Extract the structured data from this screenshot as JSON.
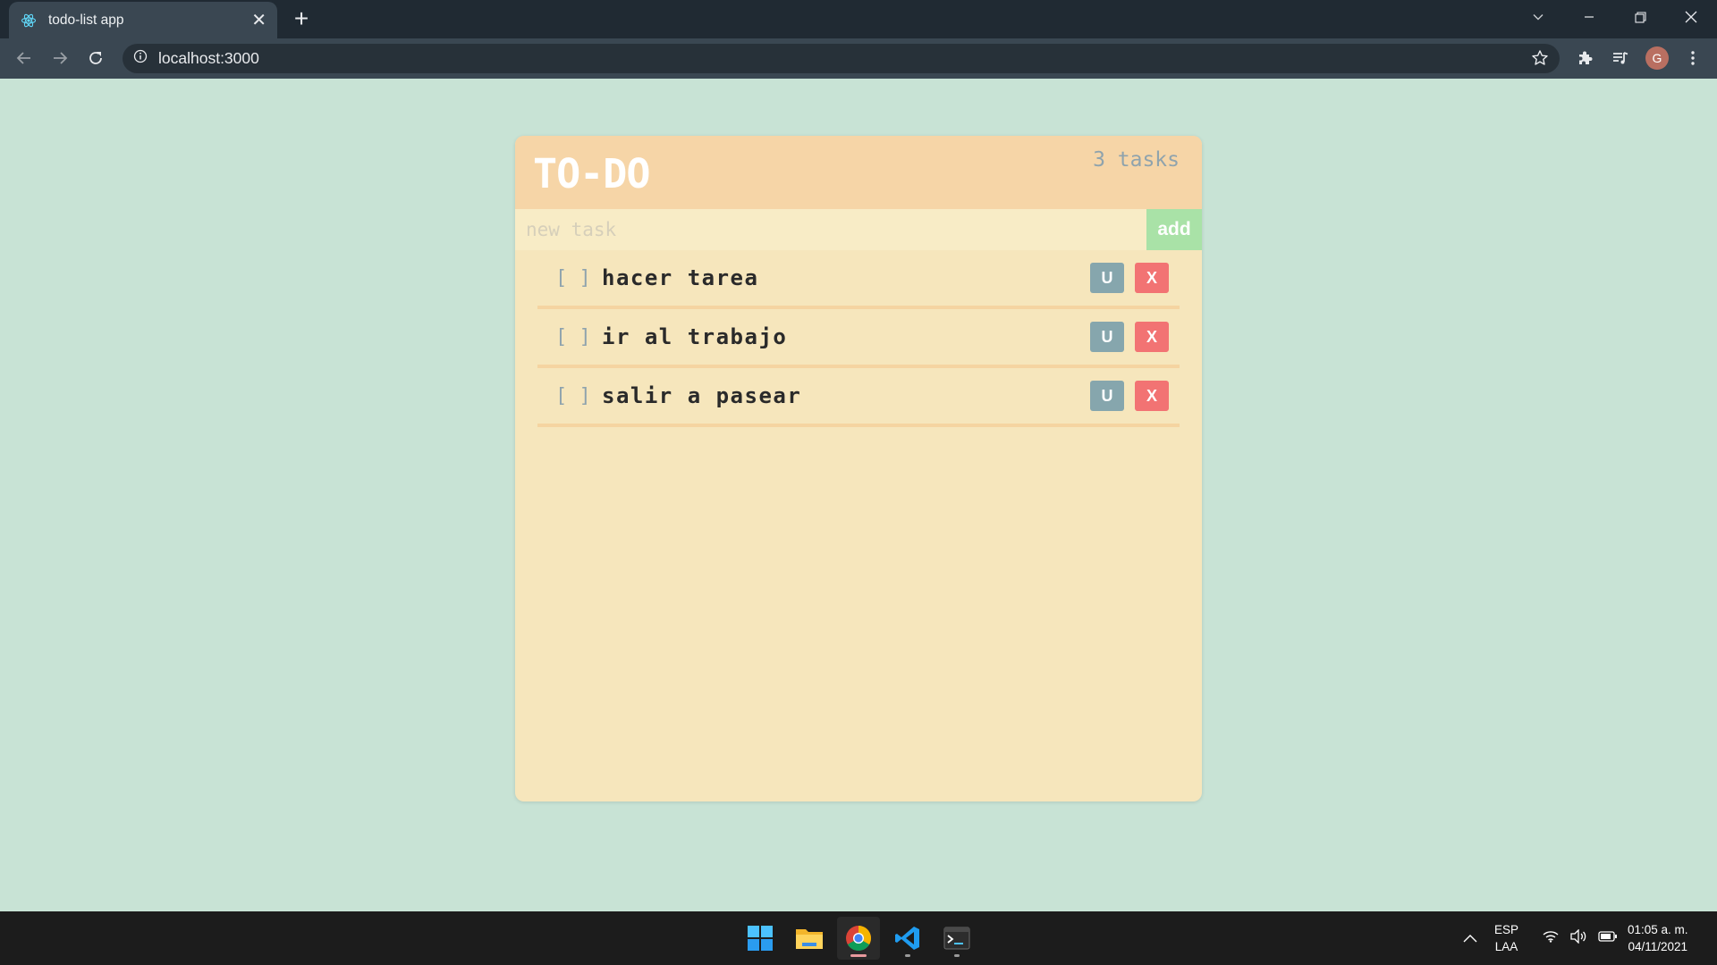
{
  "browser": {
    "tab_title": "todo-list app",
    "url": "localhost:3000",
    "profile_initial": "G"
  },
  "app": {
    "title": "TO-DO",
    "task_count": "3 tasks",
    "input": {
      "placeholder": "new task",
      "value": ""
    },
    "add_label": "add",
    "tasks": [
      {
        "checkbox": "[ ]",
        "text": "hacer tarea",
        "update_label": "U",
        "delete_label": "X"
      },
      {
        "checkbox": "[ ]",
        "text": "ir al trabajo",
        "update_label": "U",
        "delete_label": "X"
      },
      {
        "checkbox": "[ ]",
        "text": "salir a pasear",
        "update_label": "U",
        "delete_label": "X"
      }
    ]
  },
  "taskbar": {
    "apps": [
      "windows-start",
      "file-explorer",
      "chrome",
      "vscode",
      "terminal"
    ],
    "language_line1": "ESP",
    "language_line2": "LAA",
    "time": "01:05 a. m.",
    "date": "04/11/2021"
  },
  "colors": {
    "page_bg": "#c8e3d5",
    "card_bg": "#f6e6bc",
    "header_bg": "#f6d5a7",
    "add_button": "#a9e2a7",
    "update_button": "#86a6ad",
    "delete_button": "#f27373"
  }
}
